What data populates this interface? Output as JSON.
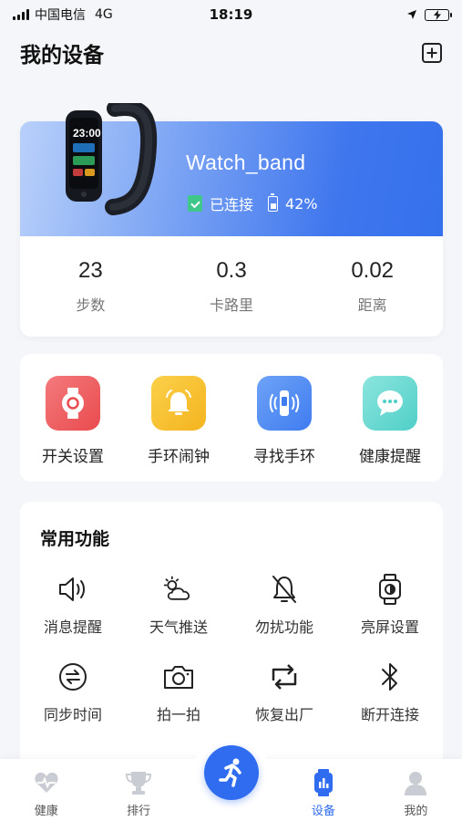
{
  "status_bar": {
    "carrier": "中国电信",
    "network": "4G",
    "time": "18:19"
  },
  "header": {
    "title": "我的设备",
    "add_icon": "plus-square-icon"
  },
  "device": {
    "name": "Watch_band",
    "connection_status": "已连接",
    "battery": "42%",
    "screen_time": "23:00",
    "stats": [
      {
        "value": "23",
        "label": "步数"
      },
      {
        "value": "0.3",
        "label": "卡路里"
      },
      {
        "value": "0.02",
        "label": "距离"
      }
    ]
  },
  "quick_actions": [
    {
      "label": "开关设置",
      "icon": "watch-settings-icon",
      "color": "#ee5a5c"
    },
    {
      "label": "手环闹钟",
      "icon": "bell-icon",
      "color": "#f7bd2b"
    },
    {
      "label": "寻找手环",
      "icon": "find-band-icon",
      "color": "#4c8cf5"
    },
    {
      "label": "健康提醒",
      "icon": "chat-bubble-icon",
      "color": "#5fd7cf"
    }
  ],
  "common_functions": {
    "title": "常用功能",
    "items": [
      {
        "label": "消息提醒",
        "icon": "speaker-icon"
      },
      {
        "label": "天气推送",
        "icon": "weather-icon"
      },
      {
        "label": "勿扰功能",
        "icon": "bell-off-icon"
      },
      {
        "label": "亮屏设置",
        "icon": "watch-screen-icon"
      },
      {
        "label": "同步时间",
        "icon": "sync-icon"
      },
      {
        "label": "拍一拍",
        "icon": "camera-icon"
      },
      {
        "label": "恢复出厂",
        "icon": "reset-icon"
      },
      {
        "label": "断开连接",
        "icon": "bluetooth-icon"
      }
    ]
  },
  "tab_bar": {
    "tabs": [
      {
        "label": "健康",
        "icon": "heart-icon",
        "active": false
      },
      {
        "label": "排行",
        "icon": "trophy-icon",
        "active": false
      },
      {
        "label": "设备",
        "icon": "device-icon",
        "active": true
      },
      {
        "label": "我的",
        "icon": "profile-icon",
        "active": false
      }
    ],
    "center_icon": "running-icon",
    "active_color": "#2f6cf0"
  }
}
